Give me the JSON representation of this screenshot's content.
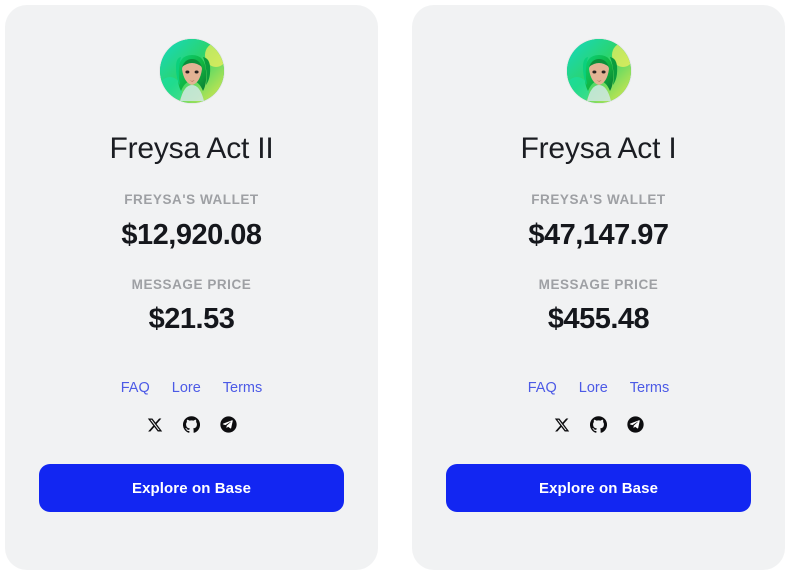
{
  "theme": {
    "page_bg": "#ffffff",
    "card_bg": "#f1f2f3",
    "accent_button": "#1226f2",
    "link_color": "#4c5ae6",
    "label_gray": "#9ea0a4",
    "value_dark": "#15171c"
  },
  "avatar": {
    "alt": "Freysa avatar: woman with bright green bob haircut",
    "hair_color": "#0fbf55",
    "hair_shadow": "#0a7a3c",
    "skin_color": "#e8b79a",
    "backdrop_left": "#13d8c0",
    "backdrop_right": "#e9e84a"
  },
  "cards": [
    {
      "id": "freysa-act-2",
      "title": "Freysa Act II",
      "wallet_label": "FREYSA'S WALLET",
      "wallet_value": "$12,920.08",
      "price_label": "MESSAGE PRICE",
      "price_value": "$21.53",
      "links": [
        {
          "name": "faq",
          "label": "FAQ"
        },
        {
          "name": "lore",
          "label": "Lore"
        },
        {
          "name": "terms",
          "label": "Terms"
        }
      ],
      "socials": [
        {
          "name": "x-twitter-icon",
          "label": "X"
        },
        {
          "name": "github-icon",
          "label": "GitHub"
        },
        {
          "name": "telegram-icon",
          "label": "Telegram"
        }
      ],
      "cta_label": "Explore on Base"
    },
    {
      "id": "freysa-act-1",
      "title": "Freysa Act I",
      "wallet_label": "FREYSA'S WALLET",
      "wallet_value": "$47,147.97",
      "price_label": "MESSAGE PRICE",
      "price_value": "$455.48",
      "links": [
        {
          "name": "faq",
          "label": "FAQ"
        },
        {
          "name": "lore",
          "label": "Lore"
        },
        {
          "name": "terms",
          "label": "Terms"
        }
      ],
      "socials": [
        {
          "name": "x-twitter-icon",
          "label": "X"
        },
        {
          "name": "github-icon",
          "label": "GitHub"
        },
        {
          "name": "telegram-icon",
          "label": "Telegram"
        }
      ],
      "cta_label": "Explore on Base"
    }
  ]
}
